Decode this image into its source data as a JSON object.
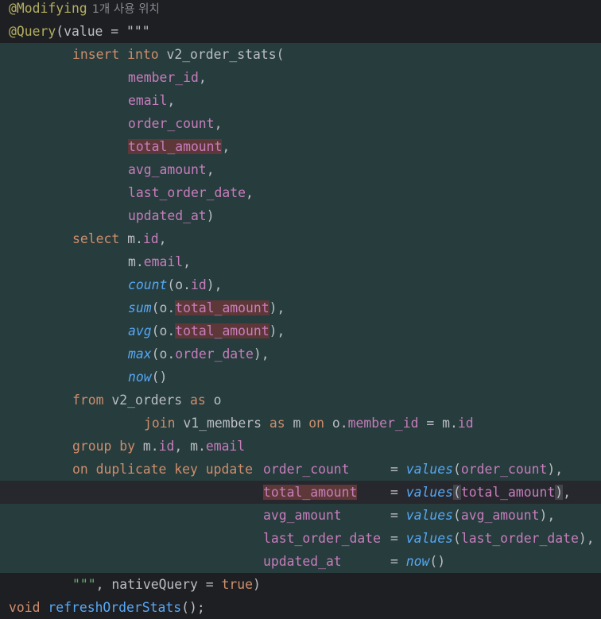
{
  "editor": {
    "annotations": {
      "modifying": "@Modifying",
      "query": "@Query",
      "usage_hint": "1개 사용 위치"
    },
    "query_open": "(value = \"\"\"",
    "sql": {
      "insert": "insert",
      "into": "into",
      "table": "v2_order_stats",
      "open_paren": "(",
      "columns": [
        "member_id",
        "email",
        "order_count",
        "total_amount",
        "avg_amount",
        "last_order_date",
        "updated_at"
      ],
      "select": "select",
      "m_prefix": "m.",
      "o_prefix": "o.",
      "id": "id",
      "email": "email",
      "count": "count",
      "sum": "sum",
      "avg": "avg",
      "max": "max",
      "now": "now",
      "order_date": "order_date",
      "from": "from",
      "orders_table": "v2_orders",
      "as": "as",
      "alias_o": "o",
      "join": "join",
      "members_table": "v1_members",
      "alias_m": "m",
      "on": "on",
      "member_id": "member_id",
      "group_by": "group by",
      "on_duplicate": "on duplicate key update",
      "values": "values",
      "equals": "="
    },
    "query_close": "\"\"\"",
    "native_query": "nativeQuery",
    "true": "true",
    "void": "void",
    "method_name": "refreshOrderStats"
  }
}
